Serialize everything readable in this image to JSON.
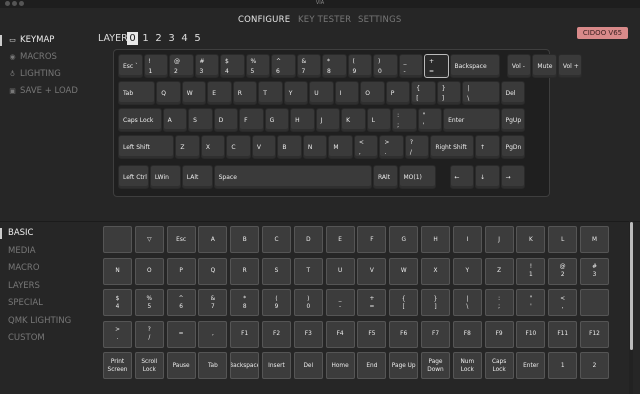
{
  "window": {
    "title": "VIA"
  },
  "nav": {
    "tabs": [
      "CONFIGURE",
      "KEY TESTER",
      "SETTINGS"
    ]
  },
  "sidebar_top": [
    {
      "label": "KEYMAP",
      "icon": "keyboard-icon"
    },
    {
      "label": "MACROS",
      "icon": "record-icon"
    },
    {
      "label": "LIGHTING",
      "icon": "bulb-icon"
    },
    {
      "label": "SAVE + LOAD",
      "icon": "floppy-disk-icon"
    }
  ],
  "sidebar_bottom": [
    "BASIC",
    "MEDIA",
    "MACRO",
    "LAYERS",
    "SPECIAL",
    "QMK LIGHTING",
    "CUSTOM"
  ],
  "layers": {
    "label": "LAYER",
    "items": [
      "0",
      "1",
      "2",
      "3",
      "4",
      "5"
    ],
    "selected": "0"
  },
  "device_badge": "CIDOO V65",
  "keyboard": {
    "row1": [
      {
        "t": "Esc `"
      },
      {
        "t": "!",
        "b": "1"
      },
      {
        "t": "@",
        "b": "2"
      },
      {
        "t": "#",
        "b": "3"
      },
      {
        "t": "$",
        "b": "4"
      },
      {
        "t": "%",
        "b": "5"
      },
      {
        "t": "^",
        "b": "6"
      },
      {
        "t": "&",
        "b": "7"
      },
      {
        "t": "*",
        "b": "8"
      },
      {
        "t": "(",
        "b": "9"
      },
      {
        "t": ")",
        "b": "0"
      },
      {
        "t": "_",
        "b": "-"
      },
      {
        "t": "+",
        "b": "="
      },
      {
        "t": "Backspace"
      },
      {
        "t": "Vol -"
      },
      {
        "t": "Mute"
      },
      {
        "t": "Vol +"
      }
    ],
    "row2": [
      {
        "t": "Tab"
      },
      {
        "t": "Q"
      },
      {
        "t": "W"
      },
      {
        "t": "E"
      },
      {
        "t": "R"
      },
      {
        "t": "T"
      },
      {
        "t": "Y"
      },
      {
        "t": "U"
      },
      {
        "t": "I"
      },
      {
        "t": "O"
      },
      {
        "t": "P"
      },
      {
        "t": "{",
        "b": "["
      },
      {
        "t": "}",
        "b": "]"
      },
      {
        "t": "|",
        "b": "\\"
      },
      {
        "t": "Del"
      }
    ],
    "row3": [
      {
        "t": "Caps Lock"
      },
      {
        "t": "A"
      },
      {
        "t": "S"
      },
      {
        "t": "D"
      },
      {
        "t": "F"
      },
      {
        "t": "G"
      },
      {
        "t": "H"
      },
      {
        "t": "J"
      },
      {
        "t": "K"
      },
      {
        "t": "L"
      },
      {
        "t": ":",
        "b": ";"
      },
      {
        "t": "\"",
        "b": "'"
      },
      {
        "t": "Enter"
      },
      {
        "t": "PgUp"
      }
    ],
    "row4": [
      {
        "t": "Left Shift"
      },
      {
        "t": "Z"
      },
      {
        "t": "X"
      },
      {
        "t": "C"
      },
      {
        "t": "V"
      },
      {
        "t": "B"
      },
      {
        "t": "N"
      },
      {
        "t": "M"
      },
      {
        "t": "<",
        "b": ","
      },
      {
        "t": ">",
        "b": "."
      },
      {
        "t": "?",
        "b": "/"
      },
      {
        "t": "Right Shift"
      },
      {
        "t": "↑"
      },
      {
        "t": "PgDn"
      }
    ],
    "row5": [
      {
        "t": "Left Ctrl"
      },
      {
        "t": "LWin"
      },
      {
        "t": "LAlt"
      },
      {
        "t": "Space"
      },
      {
        "t": "RAlt"
      },
      {
        "t": "MO(1)"
      },
      {
        "t": "←"
      },
      {
        "t": "↓"
      },
      {
        "t": "→"
      }
    ]
  },
  "palette": [
    [
      [
        "",
        ""
      ],
      [
        "▽",
        ""
      ],
      [
        "Esc",
        ""
      ],
      [
        "A",
        ""
      ],
      [
        "B",
        ""
      ],
      [
        "C",
        ""
      ],
      [
        "D",
        ""
      ],
      [
        "E",
        ""
      ],
      [
        "F",
        ""
      ],
      [
        "G",
        ""
      ],
      [
        "H",
        ""
      ],
      [
        "I",
        ""
      ],
      [
        "J",
        ""
      ],
      [
        "K",
        ""
      ],
      [
        "L",
        ""
      ],
      [
        "M",
        ""
      ]
    ],
    [
      [
        "N",
        ""
      ],
      [
        "O",
        ""
      ],
      [
        "P",
        ""
      ],
      [
        "Q",
        ""
      ],
      [
        "R",
        ""
      ],
      [
        "S",
        ""
      ],
      [
        "T",
        ""
      ],
      [
        "U",
        ""
      ],
      [
        "V",
        ""
      ],
      [
        "W",
        ""
      ],
      [
        "X",
        ""
      ],
      [
        "Y",
        ""
      ],
      [
        "Z",
        ""
      ],
      [
        "!",
        "1"
      ],
      [
        "@",
        "2"
      ],
      [
        "#",
        "3"
      ]
    ],
    [
      [
        "$",
        "4"
      ],
      [
        "%",
        "5"
      ],
      [
        "^",
        "6"
      ],
      [
        "&",
        "7"
      ],
      [
        "*",
        "8"
      ],
      [
        "(",
        "9"
      ],
      [
        ")",
        "0"
      ],
      [
        "_",
        "-"
      ],
      [
        "+",
        "="
      ],
      [
        "{",
        "["
      ],
      [
        "}",
        "]"
      ],
      [
        "|",
        "\\"
      ],
      [
        ":",
        ";"
      ],
      [
        "\"",
        "'"
      ],
      [
        "<",
        ","
      ],
      [
        "",
        ""
      ]
    ],
    [
      [
        ">",
        "."
      ],
      [
        "?",
        "/"
      ],
      [
        "=",
        ""
      ],
      [
        ",",
        ""
      ],
      [
        "F1",
        ""
      ],
      [
        "F2",
        ""
      ],
      [
        "F3",
        ""
      ],
      [
        "F4",
        ""
      ],
      [
        "F5",
        ""
      ],
      [
        "F6",
        ""
      ],
      [
        "F7",
        ""
      ],
      [
        "F8",
        ""
      ],
      [
        "F9",
        ""
      ],
      [
        "F10",
        ""
      ],
      [
        "F11",
        ""
      ],
      [
        "F12",
        ""
      ]
    ],
    [
      [
        "Print",
        "Screen"
      ],
      [
        "Scroll",
        "Lock"
      ],
      [
        "Pause",
        ""
      ],
      [
        "Tab",
        ""
      ],
      [
        "Backspace",
        ""
      ],
      [
        "Insert",
        ""
      ],
      [
        "Del",
        ""
      ],
      [
        "Home",
        ""
      ],
      [
        "End",
        ""
      ],
      [
        "Page Up",
        ""
      ],
      [
        "Page",
        "Down"
      ],
      [
        "Num",
        "Lock"
      ],
      [
        "Caps",
        "Lock"
      ],
      [
        "Enter",
        ""
      ],
      [
        "1",
        ""
      ],
      [
        "2",
        ""
      ]
    ]
  ],
  "colors": {
    "accent": "#d98a8a",
    "background": "#262626",
    "key": "#3a3a3a"
  }
}
